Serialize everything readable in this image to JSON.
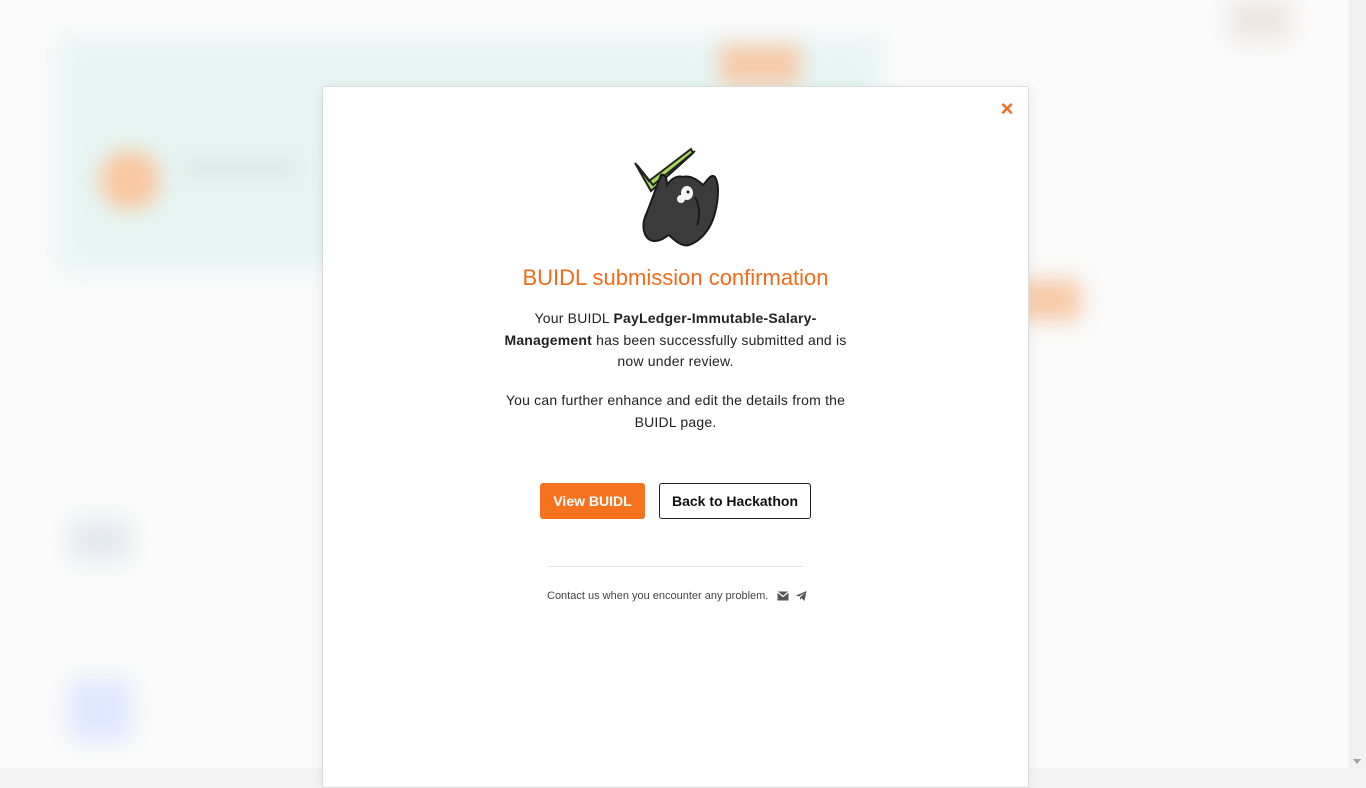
{
  "modal": {
    "close_label": "×",
    "title": "BUIDL submission confirmation",
    "desc_prefix": "Your BUIDL ",
    "buidl_name": "PayLedger-Immutable-Salary-Management",
    "desc_suffix": " has been successfully submitted and is now under review.",
    "desc_second": "You can further enhance and edit the details from the BUIDL page.",
    "primary_button": "View BUIDL",
    "secondary_button": "Back to Hackathon",
    "contact_text": "Contact us when you encounter any problem.",
    "contact_icons": [
      "mail-icon",
      "telegram-icon"
    ]
  },
  "colors": {
    "accent": "#f26a1b",
    "button_primary": "#f5721f"
  }
}
